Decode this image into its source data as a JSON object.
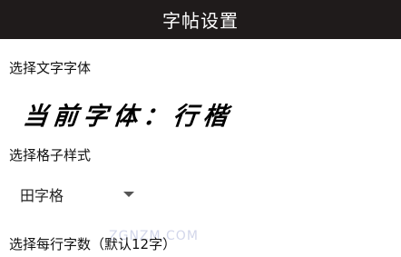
{
  "header": {
    "title": "字帖设置"
  },
  "font_section": {
    "label": "选择文字字体",
    "current_font_text": "当前字体：行楷"
  },
  "grid_section": {
    "label": "选择格子样式",
    "selected_value": "田字格"
  },
  "perline_section": {
    "label": "选择每行字数（默认12字）"
  },
  "watermark": {
    "text": "ZGNZM.COM"
  },
  "colors": {
    "titlebar_bg": "#1f1b1b",
    "titlebar_text": "#ffffff",
    "page_bg": "#ffffff"
  }
}
